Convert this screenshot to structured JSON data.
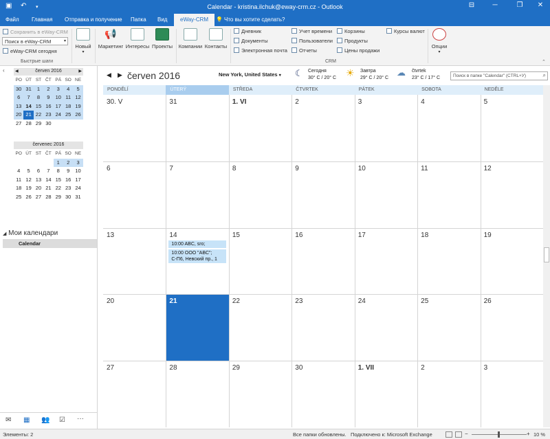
{
  "window": {
    "title": "Calendar - kristina.ilchuk@eway-crm.cz - Outlook",
    "controls": [
      "minimize",
      "restore",
      "close"
    ]
  },
  "tabs": [
    "Файл",
    "Главная",
    "Отправка и получение",
    "Папка",
    "Вид",
    "eWay-CRM"
  ],
  "tell_me": "Что вы хотите сделать?",
  "ribbon": {
    "save_to_eway": "Сохранить в eWay-CRM",
    "search_eway_placeholder": "Поиск в eWay-CRM",
    "eway_today": "eWay-CRM сегодня",
    "quick_steps_label": "Быстрые шаги",
    "new_label": "Новый",
    "marketing": "Маркетинг",
    "interests": "Интересы",
    "projects": "Проекты",
    "companies": "Компании",
    "contacts": "Контакты",
    "journal": "Дневник",
    "documents": "Документы",
    "email": "Электронная почта",
    "time_tracking": "Учет времени",
    "users": "Пользователи",
    "reports": "Отчеты",
    "carts": "Корзины",
    "products": "Продукты",
    "price_lists": "Цены продажи",
    "exchange_rates": "Курсы валют",
    "crm_label": "CRM",
    "options": "Опции"
  },
  "mini_calendars": [
    {
      "title": "červen 2016",
      "day_names": [
        "PO",
        "ÚT",
        "ST",
        "ČT",
        "PÁ",
        "SO",
        "NE"
      ],
      "weeks": [
        [
          "30",
          "31",
          "1",
          "2",
          "3",
          "4",
          "5"
        ],
        [
          "6",
          "7",
          "8",
          "9",
          "10",
          "11",
          "12"
        ],
        [
          "13",
          "14",
          "15",
          "16",
          "17",
          "18",
          "19"
        ],
        [
          "20",
          "21",
          "22",
          "23",
          "24",
          "25",
          "26"
        ],
        [
          "27",
          "28",
          "29",
          "30",
          "",
          "",
          ""
        ]
      ]
    },
    {
      "title": "červenec 2016",
      "day_names": [
        "PO",
        "ÚT",
        "ST",
        "ČT",
        "PÁ",
        "SO",
        "NE"
      ],
      "weeks": [
        [
          "",
          "",
          "",
          "",
          "1",
          "2",
          "3"
        ],
        [
          "4",
          "5",
          "6",
          "7",
          "8",
          "9",
          "10"
        ],
        [
          "11",
          "12",
          "13",
          "14",
          "15",
          "16",
          "17"
        ],
        [
          "18",
          "19",
          "20",
          "21",
          "22",
          "23",
          "24"
        ],
        [
          "25",
          "26",
          "27",
          "28",
          "29",
          "30",
          "31"
        ]
      ]
    }
  ],
  "my_calendars": "Мои календари",
  "calendar_item": "Calendar",
  "cal_header": {
    "month": "červen 2016",
    "location": "New York, United States",
    "weather": [
      {
        "day": "Сегодня",
        "temp": "30° C / 20° C"
      },
      {
        "day": "Завтра",
        "temp": "29° C / 20° C"
      },
      {
        "day": "čtvrtek",
        "temp": "23° C / 17° C"
      }
    ],
    "search_placeholder": "Поиск в папке \"Calendar\" (CTRL+У)"
  },
  "day_headers": [
    "PONDĚLÍ",
    "ÚTERÝ",
    "STŘEDA",
    "ČTVRTEK",
    "PÁTEK",
    "SOBOTA",
    "NEDĚLE"
  ],
  "weeks": [
    [
      "30. V",
      "31",
      "1. VI",
      "2",
      "3",
      "4",
      "5"
    ],
    [
      "6",
      "7",
      "8",
      "9",
      "10",
      "11",
      "12"
    ],
    [
      "13",
      "14",
      "15",
      "16",
      "17",
      "18",
      "19"
    ],
    [
      "20",
      "21",
      "22",
      "23",
      "24",
      "25",
      "26"
    ],
    [
      "27",
      "28",
      "29",
      "30",
      "1. VII",
      "2",
      "3"
    ]
  ],
  "appointments": [
    {
      "text": "10:00 ABC, sro;"
    },
    {
      "line1": "10:00 ООО \"ABC\";",
      "line2": "С-П6, Невский пр., 1"
    }
  ],
  "status": {
    "items": "Элементы: 2",
    "updated": "Все папки обновлены.",
    "connection": "Подключено к: Microsoft Exchange",
    "zoom": "10 %"
  },
  "colors": {
    "accent": "#1f6fc5",
    "today_fill": "#1f6fc5",
    "appointment": "#c7e3f8",
    "day_header": "#dfeefa"
  }
}
